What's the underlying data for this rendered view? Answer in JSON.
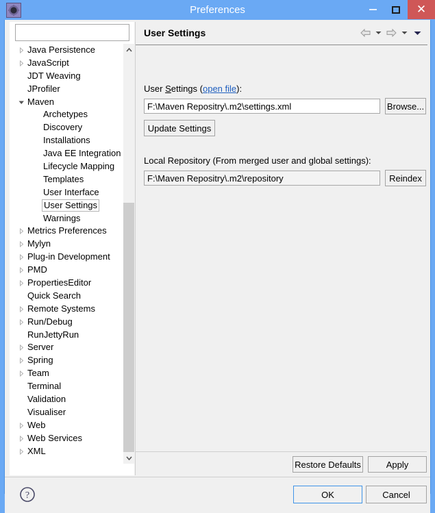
{
  "window": {
    "title": "Preferences",
    "app_icon": "gear-icon",
    "controls": {
      "minimize": "–",
      "maximize": "□",
      "close": "✕"
    },
    "accent_color": "#6aa9f4",
    "close_color": "#cf5757"
  },
  "sidebar": {
    "filter": {
      "value": "",
      "placeholder": ""
    },
    "items": [
      {
        "label": "Java Persistence",
        "level": 0,
        "expandable": true,
        "expanded": false,
        "selected": false
      },
      {
        "label": "JavaScript",
        "level": 0,
        "expandable": true,
        "expanded": false,
        "selected": false
      },
      {
        "label": "JDT Weaving",
        "level": 0,
        "expandable": false,
        "expanded": false,
        "selected": false
      },
      {
        "label": "JProfiler",
        "level": 0,
        "expandable": false,
        "expanded": false,
        "selected": false
      },
      {
        "label": "Maven",
        "level": 0,
        "expandable": true,
        "expanded": true,
        "selected": false
      },
      {
        "label": "Archetypes",
        "level": 1,
        "expandable": false,
        "expanded": false,
        "selected": false
      },
      {
        "label": "Discovery",
        "level": 1,
        "expandable": false,
        "expanded": false,
        "selected": false
      },
      {
        "label": "Installations",
        "level": 1,
        "expandable": false,
        "expanded": false,
        "selected": false
      },
      {
        "label": "Java EE Integration",
        "level": 1,
        "expandable": false,
        "expanded": false,
        "selected": false
      },
      {
        "label": "Lifecycle Mapping",
        "level": 1,
        "expandable": false,
        "expanded": false,
        "selected": false
      },
      {
        "label": "Templates",
        "level": 1,
        "expandable": false,
        "expanded": false,
        "selected": false
      },
      {
        "label": "User Interface",
        "level": 1,
        "expandable": false,
        "expanded": false,
        "selected": false
      },
      {
        "label": "User Settings",
        "level": 1,
        "expandable": false,
        "expanded": false,
        "selected": true
      },
      {
        "label": "Warnings",
        "level": 1,
        "expandable": false,
        "expanded": false,
        "selected": false
      },
      {
        "label": "Metrics Preferences",
        "level": 0,
        "expandable": true,
        "expanded": false,
        "selected": false
      },
      {
        "label": "Mylyn",
        "level": 0,
        "expandable": true,
        "expanded": false,
        "selected": false
      },
      {
        "label": "Plug-in Development",
        "level": 0,
        "expandable": true,
        "expanded": false,
        "selected": false
      },
      {
        "label": "PMD",
        "level": 0,
        "expandable": true,
        "expanded": false,
        "selected": false
      },
      {
        "label": "PropertiesEditor",
        "level": 0,
        "expandable": true,
        "expanded": false,
        "selected": false
      },
      {
        "label": "Quick Search",
        "level": 0,
        "expandable": false,
        "expanded": false,
        "selected": false
      },
      {
        "label": "Remote Systems",
        "level": 0,
        "expandable": true,
        "expanded": false,
        "selected": false
      },
      {
        "label": "Run/Debug",
        "level": 0,
        "expandable": true,
        "expanded": false,
        "selected": false
      },
      {
        "label": "RunJettyRun",
        "level": 0,
        "expandable": false,
        "expanded": false,
        "selected": false
      },
      {
        "label": "Server",
        "level": 0,
        "expandable": true,
        "expanded": false,
        "selected": false
      },
      {
        "label": "Spring",
        "level": 0,
        "expandable": true,
        "expanded": false,
        "selected": false
      },
      {
        "label": "Team",
        "level": 0,
        "expandable": true,
        "expanded": false,
        "selected": false
      },
      {
        "label": "Terminal",
        "level": 0,
        "expandable": false,
        "expanded": false,
        "selected": false
      },
      {
        "label": "Validation",
        "level": 0,
        "expandable": false,
        "expanded": false,
        "selected": false
      },
      {
        "label": "Visualiser",
        "level": 0,
        "expandable": false,
        "expanded": false,
        "selected": false
      },
      {
        "label": "Web",
        "level": 0,
        "expandable": true,
        "expanded": false,
        "selected": false
      },
      {
        "label": "Web Services",
        "level": 0,
        "expandable": true,
        "expanded": false,
        "selected": false
      },
      {
        "label": "XML",
        "level": 0,
        "expandable": true,
        "expanded": false,
        "selected": false
      }
    ]
  },
  "page": {
    "title": "User Settings",
    "nav": {
      "back_icon": "back-arrow-icon",
      "back_menu_icon": "chevron-down-icon",
      "forward_icon": "forward-arrow-icon",
      "forward_menu_icon": "chevron-down-icon",
      "view_menu_icon": "chevron-down-icon"
    },
    "user_settings": {
      "label_prefix": "User ",
      "label_mnemonic": "S",
      "label_rest": "ettings (",
      "link_text": "open file",
      "label_suffix": "):",
      "path_value": "F:\\Maven Repositry\\.m2\\settings.xml",
      "browse_label": "Browse...",
      "update_label": "Update Settings"
    },
    "local_repository": {
      "label": "Local Repository (From merged user and global settings):",
      "path_value": "F:\\Maven Repositry\\.m2\\repository",
      "reindex_label": "Reindex"
    }
  },
  "footer": {
    "restore_defaults_label": "Restore Defaults",
    "apply_label": "Apply",
    "help_icon": "help-question-icon",
    "ok_label": "OK",
    "cancel_label": "Cancel"
  }
}
